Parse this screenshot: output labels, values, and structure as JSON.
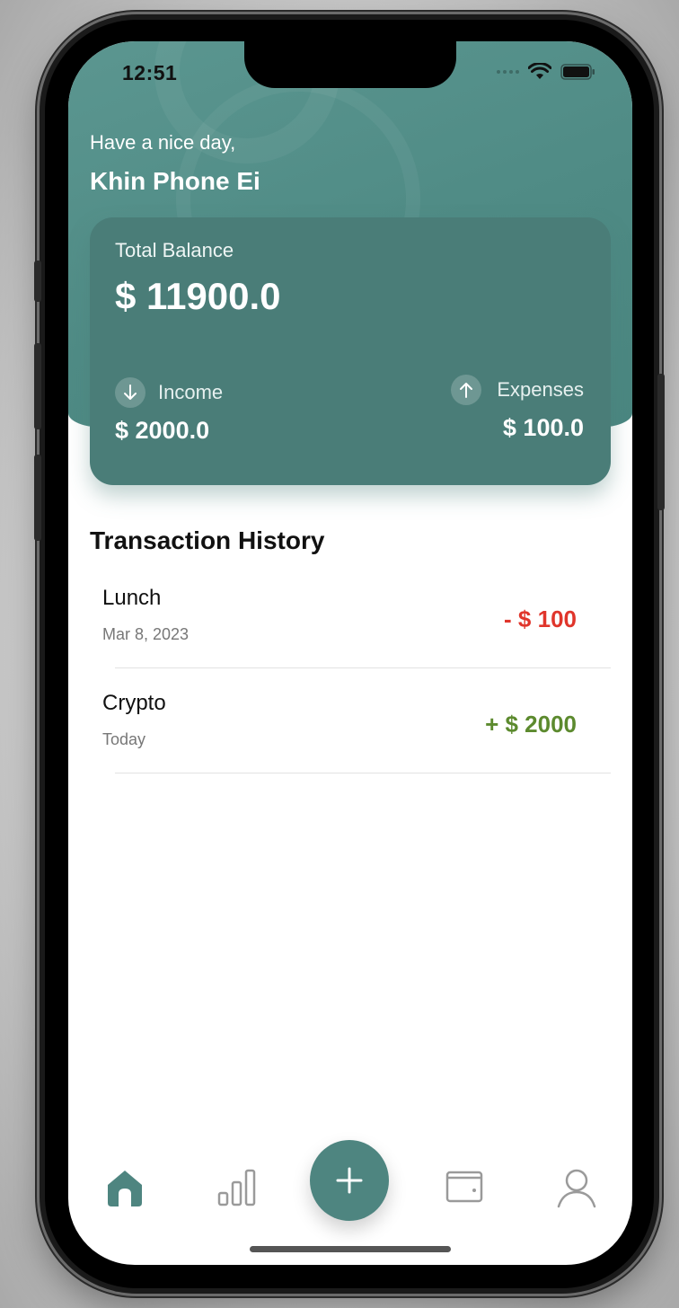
{
  "status_bar": {
    "time": "12:51"
  },
  "header": {
    "greeting": "Have a nice day,",
    "user_name": "Khin Phone Ei"
  },
  "balance_card": {
    "label": "Total Balance",
    "total": "$ 11900.0",
    "income": {
      "label": "Income",
      "amount": "$ 2000.0",
      "icon": "arrow-down-icon"
    },
    "expenses": {
      "label": "Expenses",
      "amount": "$ 100.0",
      "icon": "arrow-up-icon"
    }
  },
  "transactions": {
    "title": "Transaction History",
    "items": [
      {
        "name": "Lunch",
        "date": "Mar 8, 2023",
        "amount": "- $ 100",
        "color": "#e0352b"
      },
      {
        "name": "Crypto",
        "date": "Today",
        "amount": "+ $ 2000",
        "color": "#5c8a2e"
      }
    ]
  },
  "tab_bar": {
    "items": [
      "home-icon",
      "stats-icon",
      "add-icon",
      "wallet-icon",
      "profile-icon"
    ],
    "active_color": "#4e8580",
    "inactive_color": "#9a9a9a"
  }
}
